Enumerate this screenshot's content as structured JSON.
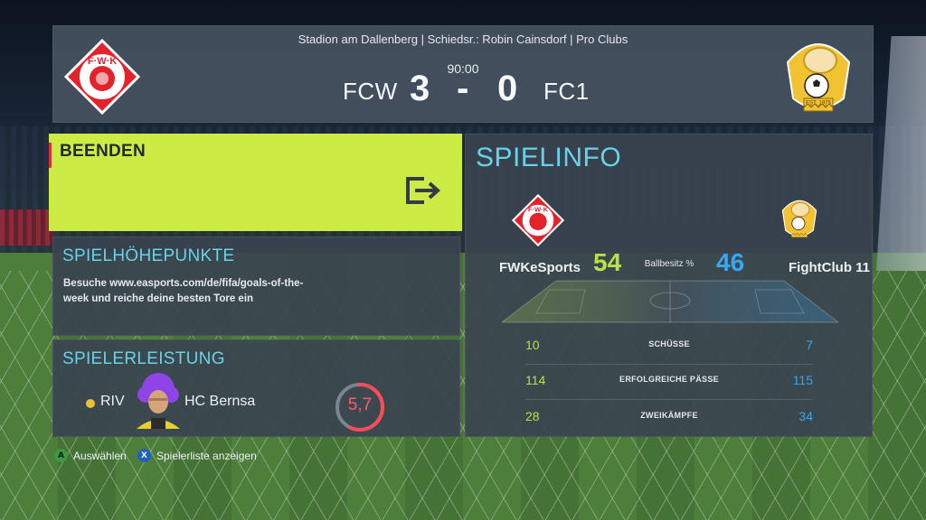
{
  "match": {
    "venue_line": "Stadion am Dallenberg | Schiedsr.: Robin Cainsdorf | Pro Clubs",
    "time": "90:00",
    "home_abbr": "FCW",
    "away_abbr": "FC1",
    "home_score": "3",
    "away_score": "0",
    "dash": "-",
    "home_logo_text": "F·W·K",
    "away_logo_text": "EST. 1975"
  },
  "exit_panel": {
    "title": "BEENDEN",
    "icon": "exit-icon"
  },
  "highlights": {
    "title": "SPIELHÖHEPUNKTE",
    "text": "Besuche www.easports.com/de/fifa/goals-of-the-week und reiche deine besten Tore ein"
  },
  "performance": {
    "title": "SPIELERLEISTUNG",
    "position": "RIV",
    "player": "HC Bernsa",
    "rating": "5,7",
    "rating_fraction": 0.57
  },
  "info": {
    "title": "SPIELINFO",
    "home_team": "FWKeSports",
    "away_team": "FightClub 11",
    "possession_label": "Ballbesitz %",
    "home_possession": "54",
    "away_possession": "46",
    "stats": [
      {
        "label": "SCHÜSSE",
        "home": "10",
        "away": "7"
      },
      {
        "label": "ERFOLGREICHE PÄSSE",
        "home": "114",
        "away": "115"
      },
      {
        "label": "ZWEIKÄMPFE",
        "home": "28",
        "away": "34"
      }
    ]
  },
  "hints": {
    "select_button": "A",
    "select_label": "Auswählen",
    "roster_button": "X",
    "roster_label": "Spielerliste anzeigen"
  },
  "colors": {
    "accent_cyan": "#67d3e8",
    "home_green": "#b9e04a",
    "away_blue": "#36a9f2",
    "exit_yellow": "#cdeb45",
    "rating_red": "#ff5a6a"
  }
}
